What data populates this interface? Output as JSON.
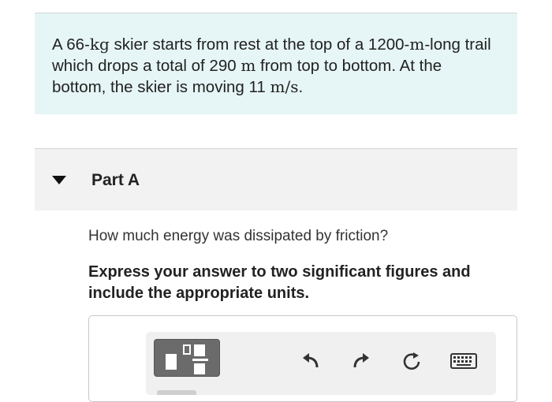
{
  "problem": {
    "segments": [
      {
        "text": "A 66-",
        "math": false
      },
      {
        "text": "kg",
        "math": true
      },
      {
        "text": " skier starts from rest at the top of a 1200-",
        "math": false
      },
      {
        "text": "m",
        "math": true
      },
      {
        "text": "-long trail which drops a total of 290 ",
        "math": false
      },
      {
        "text": "m",
        "math": true
      },
      {
        "text": " from top to bottom. At the bottom, the skier is moving 11 ",
        "math": false
      },
      {
        "text": "m/s",
        "math": true
      },
      {
        "text": ".",
        "math": false
      }
    ]
  },
  "part": {
    "title": "Part A",
    "question": "How much energy was dissipated by friction?",
    "instructions": "Express your answer to two significant figures and include the appropriate units."
  },
  "toolbar": {
    "icons": [
      "templates-icon",
      "undo-icon",
      "redo-icon",
      "reset-icon",
      "keyboard-icon"
    ]
  },
  "colors": {
    "problem_bg": "#e6f5f5",
    "part_header_bg": "#f2f2f2",
    "template_btn": "#6b6b6b"
  }
}
